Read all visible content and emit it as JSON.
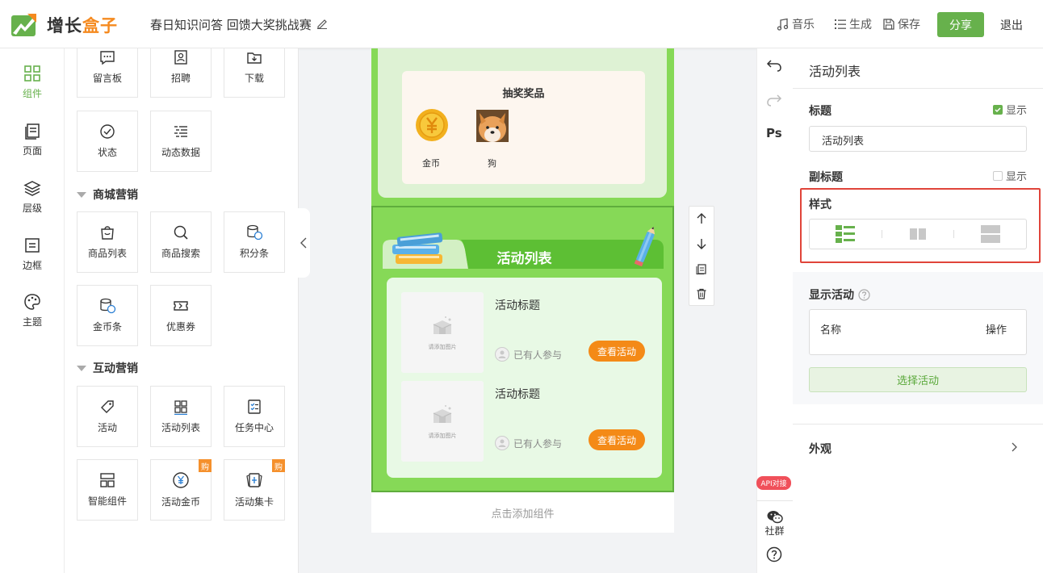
{
  "header": {
    "brand_main": "增长",
    "brand_accent": "盒子",
    "doc_title": "春日知识问答 回馈大奖挑战赛",
    "music": "音乐",
    "generate": "生成",
    "save": "保存",
    "share": "分享",
    "exit": "退出"
  },
  "rail": [
    {
      "label": "组件",
      "icon": "grid-icon"
    },
    {
      "label": "页面",
      "icon": "pages-icon"
    },
    {
      "label": "层级",
      "icon": "layers-icon"
    },
    {
      "label": "边框",
      "icon": "frame-icon"
    },
    {
      "label": "主题",
      "icon": "palette-icon"
    }
  ],
  "palette": {
    "row0": [
      "留言板",
      "招聘",
      "下载"
    ],
    "row1": [
      "状态",
      "动态数据"
    ],
    "section_mall": "商城营销",
    "mall": [
      "商品列表",
      "商品搜索",
      "积分条",
      "金币条",
      "优惠券"
    ],
    "section_interactive": "互动营销",
    "interactive": [
      "活动",
      "活动列表",
      "任务中心",
      "智能组件",
      "活动金币",
      "活动集卡"
    ],
    "buy_badge": "购"
  },
  "canvas": {
    "prize_title": "抽奖奖品",
    "prizes": [
      "金币",
      "狗"
    ],
    "list_title": "活动列表",
    "items": [
      {
        "title": "活动标题",
        "joined": "已有人参与",
        "button": "查看活动",
        "placeholder": "请添加图片"
      },
      {
        "title": "活动标题",
        "joined": "已有人参与",
        "button": "查看活动",
        "placeholder": "请添加图片"
      }
    ],
    "add_component": "点击添加组件"
  },
  "strip": {
    "ps": "Ps",
    "api": "API对接",
    "community": "社群"
  },
  "panel": {
    "title": "活动列表",
    "title_label": "标题",
    "title_show": "显示",
    "title_value": "活动列表",
    "subtitle_label": "副标题",
    "subtitle_show": "显示",
    "style_label": "样式",
    "show_activity": "显示活动",
    "col_name": "名称",
    "col_action": "操作",
    "select_activity": "选择活动",
    "appearance": "外观"
  },
  "colors": {
    "brand_green": "#67b14c",
    "accent_orange": "#f48a17",
    "canvas_green": "#86d957",
    "highlight_red": "#e0443a"
  }
}
